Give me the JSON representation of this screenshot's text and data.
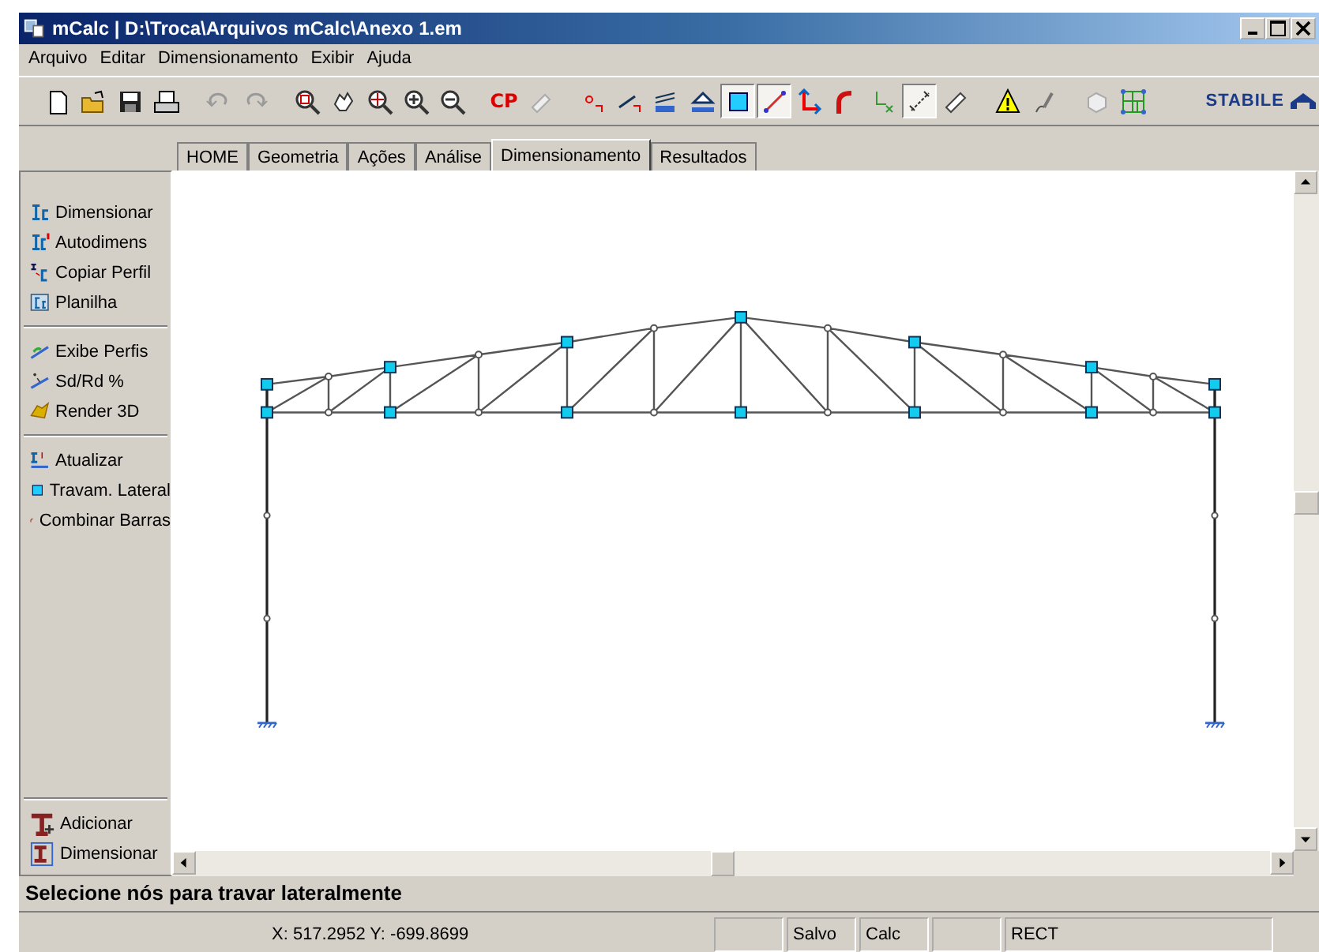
{
  "window": {
    "title": "mCalc | D:\\Troca\\Arquivos mCalc\\Anexo 1.em"
  },
  "menu": [
    "Arquivo",
    "Editar",
    "Dimensionamento",
    "Exibir",
    "Ajuda"
  ],
  "toolbar": [
    {
      "kind": "new",
      "pressed": false
    },
    {
      "kind": "open",
      "pressed": false
    },
    {
      "kind": "save",
      "pressed": false
    },
    {
      "kind": "print",
      "pressed": false
    },
    {
      "kind": "sep"
    },
    {
      "kind": "undo",
      "pressed": false
    },
    {
      "kind": "redo",
      "pressed": false
    },
    {
      "kind": "sep"
    },
    {
      "kind": "zoom-window",
      "pressed": false
    },
    {
      "kind": "pan",
      "pressed": false
    },
    {
      "kind": "zoom-extents",
      "pressed": false
    },
    {
      "kind": "zoom-in",
      "pressed": false
    },
    {
      "kind": "zoom-out",
      "pressed": false
    },
    {
      "kind": "sep"
    },
    {
      "kind": "text",
      "label": "CP",
      "pressed": false
    },
    {
      "kind": "eraser",
      "pressed": false
    },
    {
      "kind": "sep"
    },
    {
      "kind": "node",
      "pressed": false
    },
    {
      "kind": "bar",
      "pressed": false
    },
    {
      "kind": "bars",
      "pressed": false
    },
    {
      "kind": "support",
      "pressed": false
    },
    {
      "kind": "square",
      "pressed": true
    },
    {
      "kind": "line",
      "pressed": true
    },
    {
      "kind": "axes",
      "pressed": false
    },
    {
      "kind": "curve",
      "pressed": false
    },
    {
      "kind": "local-axes",
      "pressed": false
    },
    {
      "kind": "dimension",
      "pressed": true
    },
    {
      "kind": "ruler",
      "pressed": false
    },
    {
      "kind": "sep"
    },
    {
      "kind": "warning",
      "pressed": false
    },
    {
      "kind": "sign",
      "pressed": false
    },
    {
      "kind": "sep"
    },
    {
      "kind": "view-3d",
      "pressed": false
    },
    {
      "kind": "frame",
      "pressed": false
    }
  ],
  "brand": "STABILE",
  "tabs": [
    {
      "label": "HOME",
      "selected": false
    },
    {
      "label": "Geometria",
      "selected": false
    },
    {
      "label": "Ações",
      "selected": false
    },
    {
      "label": "Análise",
      "selected": false
    },
    {
      "label": "Dimensionamento",
      "selected": true
    },
    {
      "label": "Resultados",
      "selected": false
    }
  ],
  "sidebar": {
    "groups": [
      [
        {
          "label": "Dimensionar",
          "kind": "profile"
        },
        {
          "label": "Autodimens",
          "kind": "profile-auto"
        },
        {
          "label": "Copiar Perfil",
          "kind": "profile-copy"
        },
        {
          "label": "Planilha",
          "kind": "sheet"
        }
      ],
      [
        {
          "label": "Exibe Perfis",
          "kind": "show-profiles"
        },
        {
          "label": "Sd/Rd %",
          "kind": "ratio"
        },
        {
          "label": "Render 3D",
          "kind": "render"
        }
      ],
      [
        {
          "label": "Atualizar",
          "kind": "update"
        },
        {
          "label": "Travam. Lateral",
          "kind": "square"
        },
        {
          "label": "Combinar Barras",
          "kind": "curve"
        }
      ]
    ],
    "bottom": [
      {
        "label": "Adicionar",
        "kind": "beam-add"
      },
      {
        "label": "Dimensionar",
        "kind": "beam"
      }
    ]
  },
  "message": "Selecione nós para travar lateralmente",
  "status_bar": {
    "coordinates": "X: 517.2952  Y: -699.8699",
    "fields": [
      "Salvo",
      "Calc",
      "RECT"
    ]
  }
}
